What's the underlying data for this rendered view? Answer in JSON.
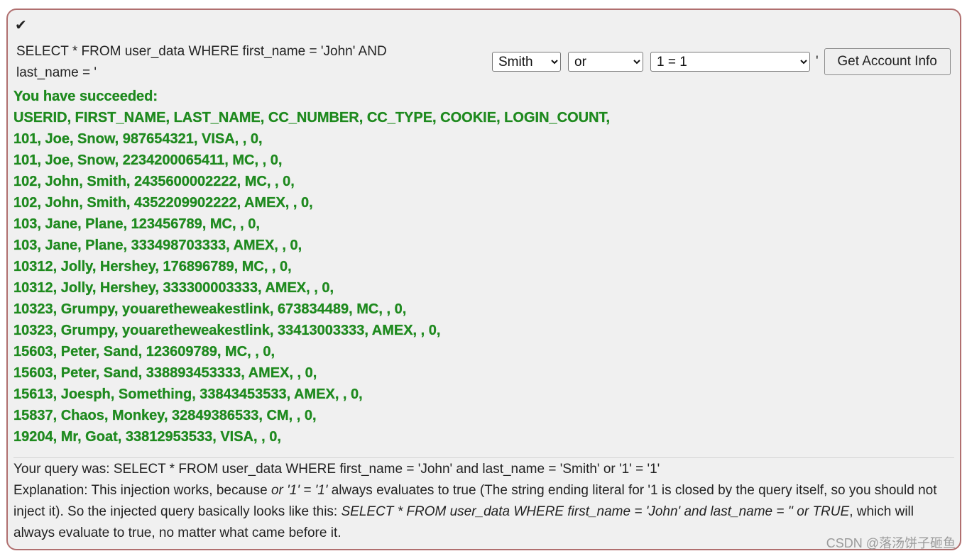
{
  "icons": {
    "check": "checkmark-icon"
  },
  "colors": {
    "success_text": "#1f8a1f",
    "panel_border": "#b06f6f",
    "panel_bg": "#f0f0f0"
  },
  "query": {
    "line1": "SELECT * FROM user_data WHERE first_name = 'John' AND",
    "line2": "last_name = '"
  },
  "controls": {
    "lastname_selected": "Smith",
    "operator_selected": "or",
    "condition_selected": "1 = 1",
    "closing_quote": "'",
    "button_label": "Get Account Info"
  },
  "results": {
    "success_message": "You have succeeded:",
    "header": "USERID, FIRST_NAME, LAST_NAME, CC_NUMBER, CC_TYPE, COOKIE, LOGIN_COUNT,",
    "rows": [
      "101, Joe, Snow, 987654321, VISA, , 0,",
      "101, Joe, Snow, 2234200065411, MC, , 0,",
      "102, John, Smith, 2435600002222, MC, , 0,",
      "102, John, Smith, 4352209902222, AMEX, , 0,",
      "103, Jane, Plane, 123456789, MC, , 0,",
      "103, Jane, Plane, 333498703333, AMEX, , 0,",
      "10312, Jolly, Hershey, 176896789, MC, , 0,",
      "10312, Jolly, Hershey, 333300003333, AMEX, , 0,",
      "10323, Grumpy, youaretheweakestlink, 673834489, MC, , 0,",
      "10323, Grumpy, youaretheweakestlink, 33413003333, AMEX, , 0,",
      "15603, Peter, Sand, 123609789, MC, , 0,",
      "15603, Peter, Sand, 338893453333, AMEX, , 0,",
      "15613, Joesph, Something, 33843453533, AMEX, , 0,",
      "15837, Chaos, Monkey, 32849386533, CM, , 0,",
      "19204, Mr, Goat, 33812953533, VISA, , 0,"
    ]
  },
  "explanation": {
    "your_query": "Your query was: SELECT * FROM user_data WHERE first_name = 'John' and last_name = 'Smith' or '1' = '1'",
    "part1": "Explanation: This injection works, because ",
    "italic1": "or '1' = '1'",
    "part2": " always evaluates to true (The string ending literal for '1 is closed by the query itself, so you should not inject it). So the injected query basically looks like this: ",
    "italic2": "SELECT * FROM user_data WHERE first_name = 'John' and last_name = '' or TRUE",
    "part3": ", which will always evaluate to true, no matter what came before it."
  },
  "watermark": "CSDN @落汤饼子砸鱼"
}
